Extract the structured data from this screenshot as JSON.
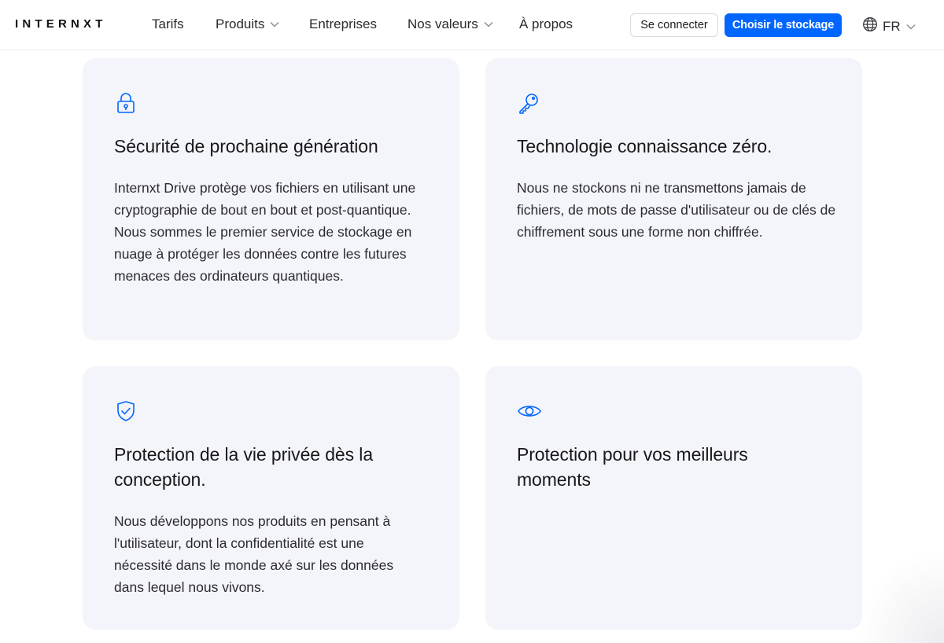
{
  "header": {
    "logo": "INTERNXT",
    "nav": [
      {
        "label": "Tarifs"
      },
      {
        "label": "Produits"
      },
      {
        "label": "Entreprises"
      },
      {
        "label": "Nos valeurs"
      },
      {
        "label": "À propos"
      }
    ],
    "login_label": "Se connecter",
    "cta_label": "Choisir le stockage",
    "language": "FR"
  },
  "colors": {
    "accent": "#0066ff",
    "card_bg": "#f4f5fa"
  },
  "features": [
    {
      "icon": "lock-icon",
      "title": "Sécurité de prochaine génération",
      "text": "Internxt Drive protège vos fichiers en utilisant une cryptographie de bout en bout et post-quantique. Nous sommes le premier service de stockage en nuage à protéger les données contre les futures menaces des ordinateurs quantiques."
    },
    {
      "icon": "key-icon",
      "title": "Technologie connaissance zéro.",
      "text": "Nous ne stockons ni ne transmettons jamais de fichiers, de mots de passe d'utilisateur ou de clés de chiffrement sous une forme non chiffrée."
    },
    {
      "icon": "shield-check-icon",
      "title": "Protection de la vie privée dès la conception.",
      "text": "Nous développons nos produits en pensant à l'utilisateur, dont la confidentialité est une nécessité dans le monde axé sur les données dans lequel nous vivons."
    },
    {
      "icon": "eye-icon",
      "title": "Protection pour vos meilleurs moments",
      "text": ""
    }
  ]
}
